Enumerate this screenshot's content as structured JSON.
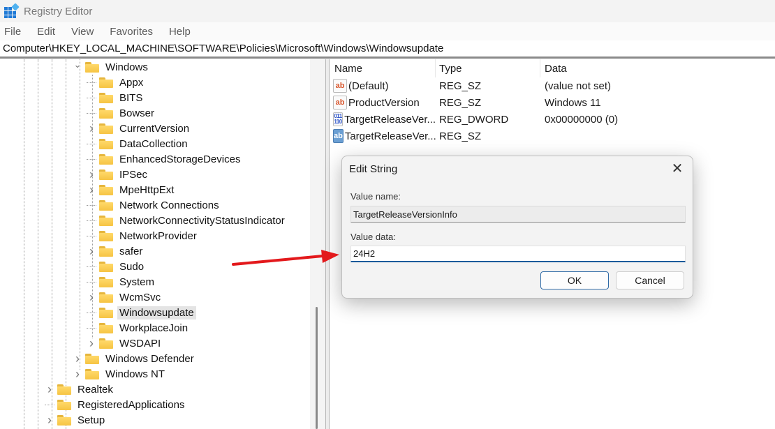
{
  "window": {
    "title": "Registry Editor"
  },
  "menu": [
    "File",
    "Edit",
    "View",
    "Favorites",
    "Help"
  ],
  "address": "Computer\\HKEY_LOCAL_MACHINE\\SOFTWARE\\Policies\\Microsoft\\Windows\\Windowsupdate",
  "tree": [
    {
      "label": "Windows",
      "level": 2,
      "expander": "expanded"
    },
    {
      "label": "Appx",
      "level": 3,
      "expander": "none"
    },
    {
      "label": "BITS",
      "level": 3,
      "expander": "none"
    },
    {
      "label": "Bowser",
      "level": 3,
      "expander": "none"
    },
    {
      "label": "CurrentVersion",
      "level": 3,
      "expander": "collapsed"
    },
    {
      "label": "DataCollection",
      "level": 3,
      "expander": "none"
    },
    {
      "label": "EnhancedStorageDevices",
      "level": 3,
      "expander": "none"
    },
    {
      "label": "IPSec",
      "level": 3,
      "expander": "collapsed"
    },
    {
      "label": "MpeHttpExt",
      "level": 3,
      "expander": "collapsed"
    },
    {
      "label": "Network Connections",
      "level": 3,
      "expander": "none"
    },
    {
      "label": "NetworkConnectivityStatusIndicator",
      "level": 3,
      "expander": "none"
    },
    {
      "label": "NetworkProvider",
      "level": 3,
      "expander": "none"
    },
    {
      "label": "safer",
      "level": 3,
      "expander": "collapsed"
    },
    {
      "label": "Sudo",
      "level": 3,
      "expander": "none"
    },
    {
      "label": "System",
      "level": 3,
      "expander": "none"
    },
    {
      "label": "WcmSvc",
      "level": 3,
      "expander": "collapsed"
    },
    {
      "label": "Windowsupdate",
      "level": 3,
      "expander": "none",
      "selected": true
    },
    {
      "label": "WorkplaceJoin",
      "level": 3,
      "expander": "none"
    },
    {
      "label": "WSDAPI",
      "level": 3,
      "expander": "collapsed"
    },
    {
      "label": "Windows Defender",
      "level": 2,
      "expander": "collapsed"
    },
    {
      "label": "Windows NT",
      "level": 2,
      "expander": "collapsed"
    },
    {
      "label": "Realtek",
      "level": 1,
      "expander": "collapsed"
    },
    {
      "label": "RegisteredApplications",
      "level": 1,
      "expander": "none"
    },
    {
      "label": "Setup",
      "level": 1,
      "expander": "collapsed"
    }
  ],
  "list": {
    "columns": [
      "Name",
      "Type",
      "Data"
    ],
    "rows": [
      {
        "icon": "string-value-icon",
        "name": "(Default)",
        "type": "REG_SZ",
        "data": "(value not set)"
      },
      {
        "icon": "string-value-icon",
        "name": "ProductVersion",
        "type": "REG_SZ",
        "data": "Windows 11"
      },
      {
        "icon": "dword-value-icon",
        "name": "TargetReleaseVer...",
        "type": "REG_DWORD",
        "data": "0x00000000 (0)"
      },
      {
        "icon": "string-value-icon",
        "name": "TargetReleaseVer...",
        "type": "REG_SZ",
        "data": "",
        "selected": true
      }
    ]
  },
  "dialog": {
    "title": "Edit String",
    "value_name_label": "Value name:",
    "value_name": "TargetReleaseVersionInfo",
    "value_data_label": "Value data:",
    "value_data": "24H2",
    "ok": "OK",
    "cancel": "Cancel"
  },
  "annotation": {
    "arrow_color": "#e3191c"
  }
}
